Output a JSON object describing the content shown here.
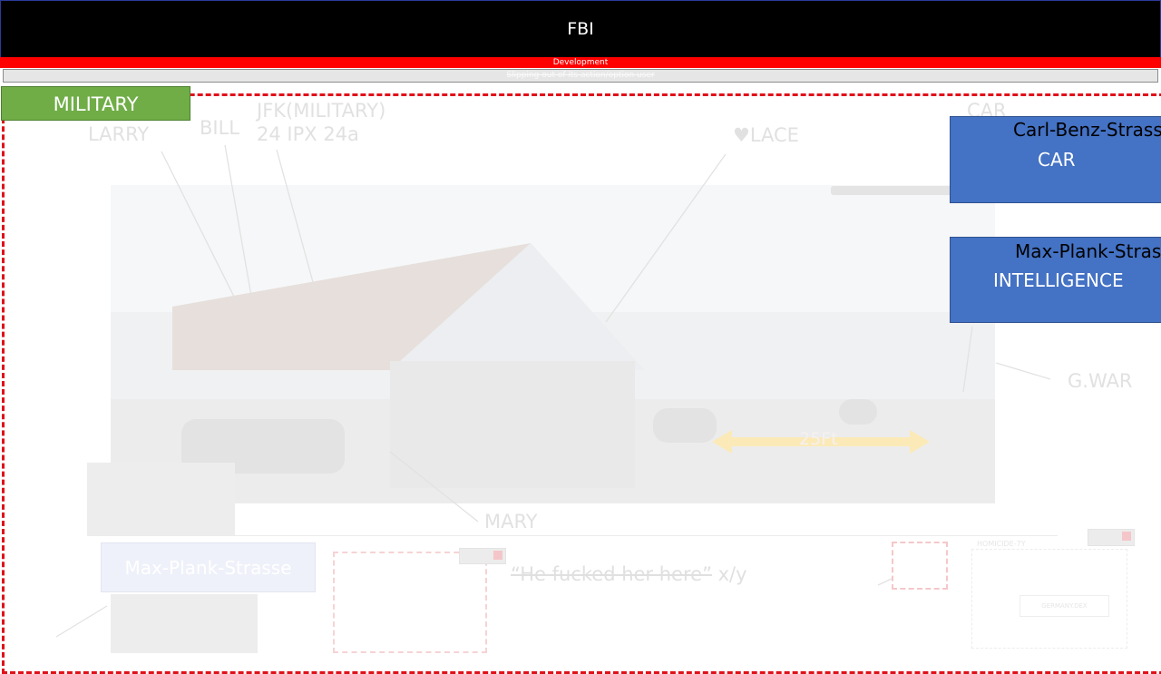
{
  "header": {
    "title": "FBI",
    "status_label": "Development",
    "sub_label": "Slipping out of its action/option user"
  },
  "colors": {
    "header_bg": "#000000",
    "status_strip": "#ff0000",
    "military_badge": "#70ad47",
    "blue_box": "#4472c4",
    "dashed_frame": "#e0101a"
  },
  "badge": {
    "military": "MILITARY"
  },
  "labels": {
    "larry": "LARRY",
    "bill": "BILL",
    "jfk": "JFK(MILITARY)",
    "jfk_sub": "24 IPX 24a",
    "lace": "♥LACE",
    "car_faint": "CAR",
    "gwar": "G.WAR",
    "mary": "MARY",
    "distance": "25Ft"
  },
  "boxes": {
    "car": {
      "street": "Carl-Benz-Strasse",
      "label": "CAR"
    },
    "intel": {
      "street": "Max-Plank-Strasse",
      "label": "INTELLIGENCE"
    },
    "max_faint": "Max-Plank-Strasse"
  },
  "quote": {
    "text": "“He fucked her here”",
    "suffix": " x/y"
  },
  "doc": {
    "title": "HOMICIDE-7Y",
    "inner": "GERMANY.DEX"
  }
}
